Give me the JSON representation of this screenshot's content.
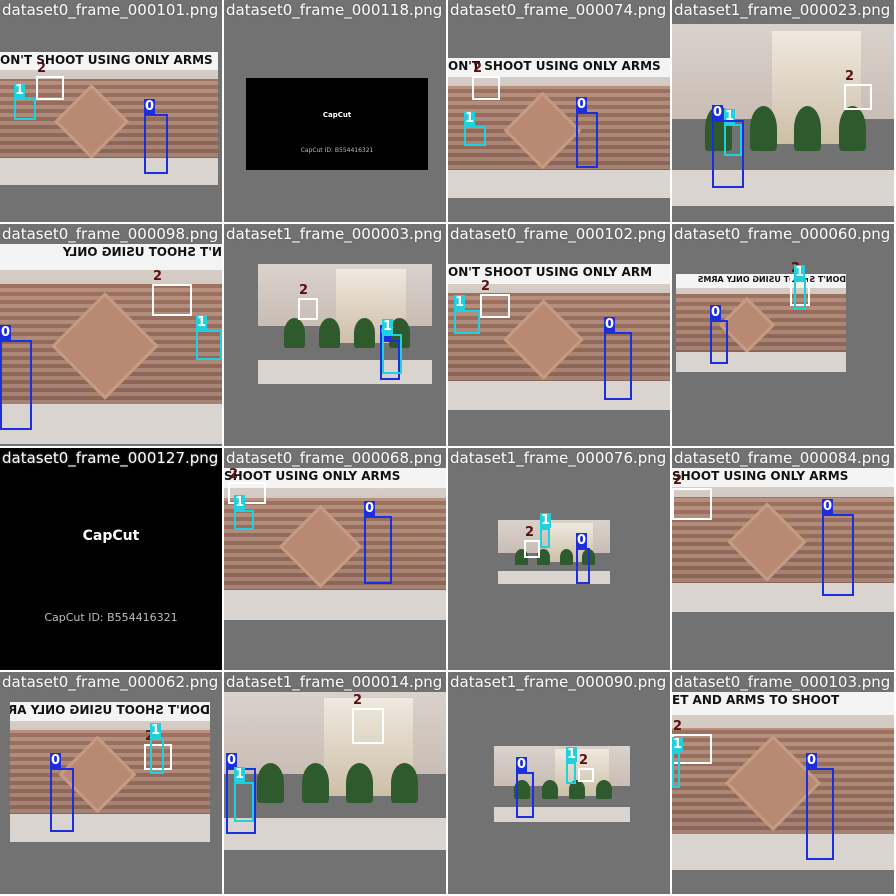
{
  "grid": {
    "columns": 4,
    "rows": 4
  },
  "palette": {
    "class0": "#1b2fdc",
    "class1": "#1fd0de",
    "class2": "#ffffff",
    "letterbox_gray": "#727272",
    "filename_text": "#ffffff"
  },
  "tiles": [
    {
      "filename": "dataset0_frame_000101.png",
      "scene": "wall",
      "banner": "ON'T SHOOT USING ONLY ARMS",
      "banner_flipped": false,
      "labels": [
        "2",
        "1",
        "0"
      ]
    },
    {
      "filename": "dataset0_frame_000118.png",
      "scene": "capcut",
      "capcut_logo": "CapCut",
      "capcut_id": "CapCut ID: B554416321",
      "labels": []
    },
    {
      "filename": "dataset0_frame_000074.png",
      "scene": "wall",
      "banner": "ON'T SHOOT USING ONLY ARMS",
      "banner_flipped": false,
      "labels": [
        "2",
        "1",
        "0"
      ]
    },
    {
      "filename": "dataset1_frame_000023.png",
      "scene": "buildings",
      "labels": [
        "2",
        "0",
        "1"
      ]
    },
    {
      "filename": "dataset0_frame_000098.png",
      "scene": "wall",
      "banner": "N'T SHOOT USING ONLY",
      "banner_flipped": true,
      "labels": [
        "2",
        "1",
        "0"
      ]
    },
    {
      "filename": "dataset1_frame_000003.png",
      "scene": "buildings",
      "labels": [
        "2",
        "0",
        "1"
      ]
    },
    {
      "filename": "dataset0_frame_000102.png",
      "scene": "wall",
      "banner": "ON'T SHOOT USING ONLY ARM",
      "banner_flipped": false,
      "labels": [
        "2",
        "1",
        "0"
      ]
    },
    {
      "filename": "dataset0_frame_000060.png",
      "scene": "wall",
      "banner": "DON'T SHOOT USING ONLY ARMS",
      "banner_flipped": true,
      "labels": [
        "2",
        "1",
        "0"
      ]
    },
    {
      "filename": "dataset0_frame_000127.png",
      "scene": "capcut",
      "capcut_logo": "CapCut",
      "capcut_id": "CapCut ID: B554416321",
      "labels": []
    },
    {
      "filename": "dataset0_frame_000068.png",
      "scene": "wall",
      "banner": "SHOOT USING ONLY ARMS",
      "banner_flipped": false,
      "labels": [
        "2",
        "1",
        "0"
      ]
    },
    {
      "filename": "dataset1_frame_000076.png",
      "scene": "buildings",
      "labels": [
        "2",
        "1",
        "0"
      ]
    },
    {
      "filename": "dataset0_frame_000084.png",
      "scene": "wall",
      "banner": "SHOOT USING ONLY ARMS",
      "banner_flipped": false,
      "labels": [
        "2",
        "0"
      ]
    },
    {
      "filename": "dataset0_frame_000062.png",
      "scene": "wall",
      "banner": "DON'T SHOOT USING ONLY ARMS",
      "banner_flipped": true,
      "labels": [
        "2",
        "1",
        "0"
      ]
    },
    {
      "filename": "dataset1_frame_000014.png",
      "scene": "buildings",
      "labels": [
        "2",
        "0",
        "1"
      ]
    },
    {
      "filename": "dataset1_frame_000090.png",
      "scene": "buildings",
      "labels": [
        "2",
        "0",
        "1"
      ]
    },
    {
      "filename": "dataset0_frame_000103.png",
      "scene": "wall",
      "banner": "ET AND ARMS TO SHOOT",
      "banner_flipped": false,
      "labels": [
        "2",
        "1",
        "0"
      ]
    }
  ]
}
